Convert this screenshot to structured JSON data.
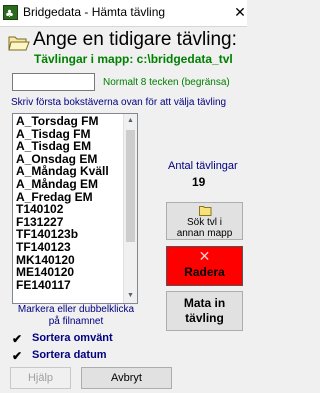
{
  "window": {
    "title": "Bridgedata - Hämta tävling",
    "close_glyph": "✕"
  },
  "header": {
    "title": "Ange en tidigare tävling:",
    "folder_line": "Tävlingar i mapp: c:\\bridgedata_tvl"
  },
  "name_input": {
    "value": "",
    "hint": "Normalt 8 tecken (begränsa)"
  },
  "instruction": "Skriv första bokstäverna ovan för att välja tävling",
  "list": {
    "items": [
      "A_Torsdag FM",
      "A_Tisdag FM",
      "A_Tisdag EM",
      "A_Onsdag EM",
      "A_Måndag Kväll",
      "A_Måndag EM",
      "A_Fredag EM",
      "T140102",
      "F131227",
      "TF140123b",
      "TF140123",
      "MK140120",
      "ME140120",
      "FE140117"
    ]
  },
  "count": {
    "label": "Antal tävlingar",
    "value": "19"
  },
  "buttons": {
    "search_label_1": "Sök tvl i",
    "search_label_2": "annan mapp",
    "delete_label": "Radera",
    "delete_glyph": "✕",
    "enter_label_1": "Mata in",
    "enter_label_2": "tävling",
    "help_label": "Hjälp",
    "cancel_label": "Avbryt"
  },
  "markera_1": "Markera eller dubbelklicka",
  "markera_2": "på filnamnet",
  "checks": [
    {
      "label": "Sortera omvänt",
      "glyph": "✔"
    },
    {
      "label": "Sortera datum",
      "glyph": "✔"
    }
  ],
  "colors": {
    "accent_green": "#008000",
    "label_blue": "#000080",
    "delete_red": "#ff0000"
  }
}
